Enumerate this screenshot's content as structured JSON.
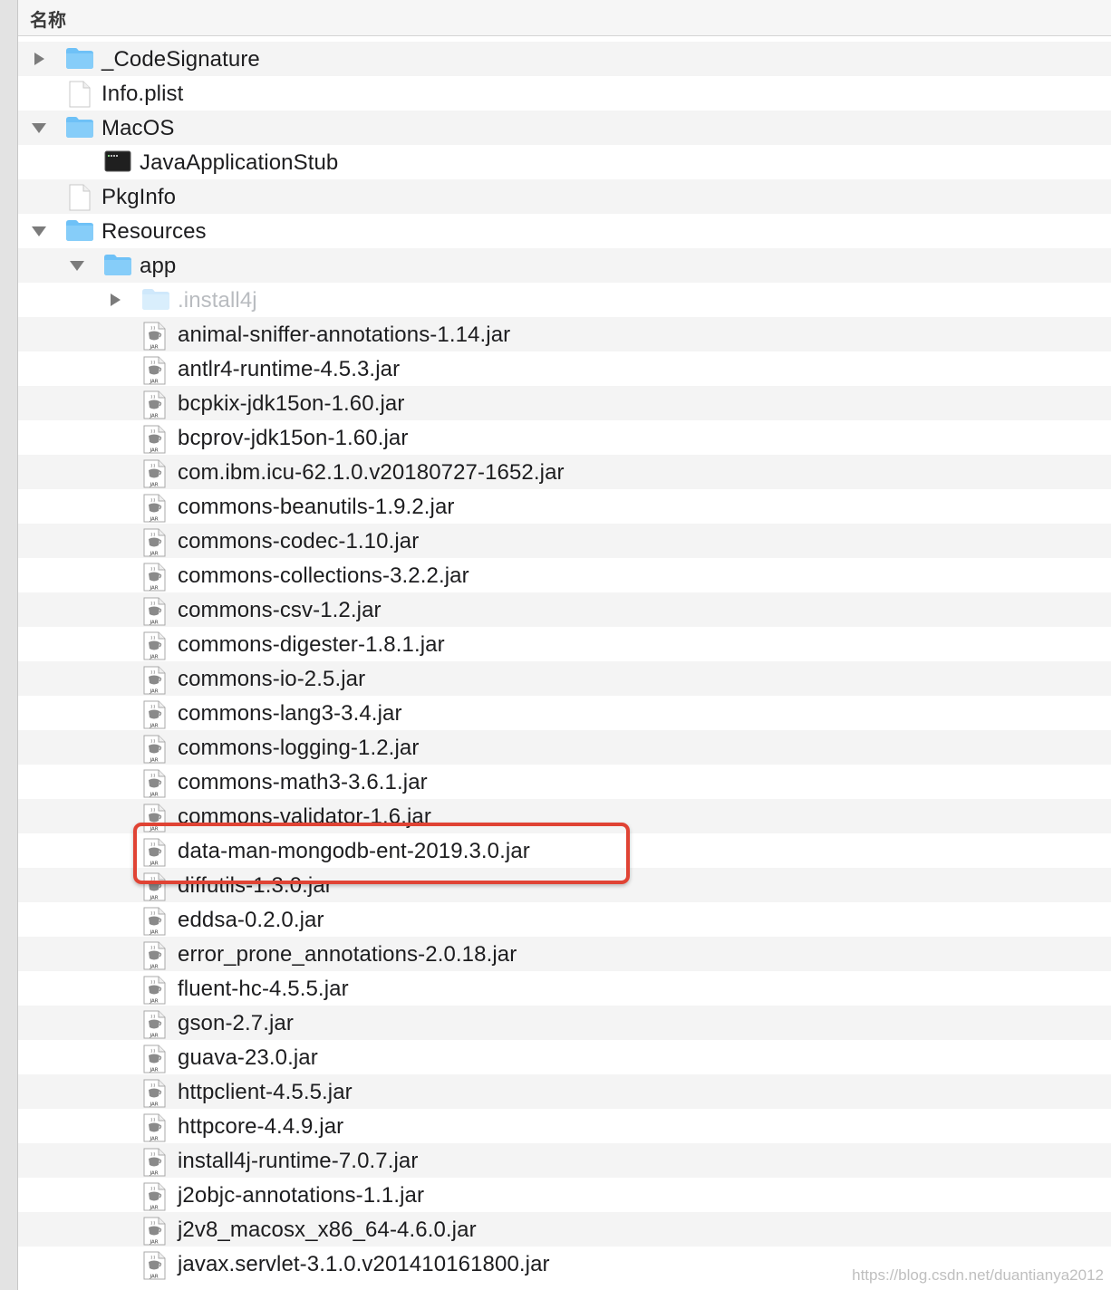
{
  "header": {
    "column_name": "名称"
  },
  "colors": {
    "folder": "#6ec1f7",
    "highlight": "#e04334",
    "row_alt": "#f4f4f4"
  },
  "rows": [
    {
      "label": "_CodeSignature",
      "icon": "folder-icon",
      "level": 0,
      "disclosure": "collapsed"
    },
    {
      "label": "Info.plist",
      "icon": "document-icon",
      "level": 0,
      "disclosure": "none"
    },
    {
      "label": "MacOS",
      "icon": "folder-icon",
      "level": 0,
      "disclosure": "expanded"
    },
    {
      "label": "JavaApplicationStub",
      "icon": "terminal-executable-icon",
      "level": 1,
      "disclosure": "none"
    },
    {
      "label": "PkgInfo",
      "icon": "document-icon",
      "level": 0,
      "disclosure": "none"
    },
    {
      "label": "Resources",
      "icon": "folder-icon",
      "level": 0,
      "disclosure": "expanded"
    },
    {
      "label": "app",
      "icon": "folder-icon",
      "level": 1,
      "disclosure": "expanded"
    },
    {
      "label": ".install4j",
      "icon": "folder-icon",
      "level": 2,
      "disclosure": "collapsed",
      "dim": true
    },
    {
      "label": "animal-sniffer-annotations-1.14.jar",
      "icon": "jar-icon",
      "level": 2
    },
    {
      "label": "antlr4-runtime-4.5.3.jar",
      "icon": "jar-icon",
      "level": 2
    },
    {
      "label": "bcpkix-jdk15on-1.60.jar",
      "icon": "jar-icon",
      "level": 2
    },
    {
      "label": "bcprov-jdk15on-1.60.jar",
      "icon": "jar-icon",
      "level": 2
    },
    {
      "label": "com.ibm.icu-62.1.0.v20180727-1652.jar",
      "icon": "jar-icon",
      "level": 2
    },
    {
      "label": "commons-beanutils-1.9.2.jar",
      "icon": "jar-icon",
      "level": 2
    },
    {
      "label": "commons-codec-1.10.jar",
      "icon": "jar-icon",
      "level": 2
    },
    {
      "label": "commons-collections-3.2.2.jar",
      "icon": "jar-icon",
      "level": 2
    },
    {
      "label": "commons-csv-1.2.jar",
      "icon": "jar-icon",
      "level": 2
    },
    {
      "label": "commons-digester-1.8.1.jar",
      "icon": "jar-icon",
      "level": 2
    },
    {
      "label": "commons-io-2.5.jar",
      "icon": "jar-icon",
      "level": 2
    },
    {
      "label": "commons-lang3-3.4.jar",
      "icon": "jar-icon",
      "level": 2
    },
    {
      "label": "commons-logging-1.2.jar",
      "icon": "jar-icon",
      "level": 2
    },
    {
      "label": "commons-math3-3.6.1.jar",
      "icon": "jar-icon",
      "level": 2
    },
    {
      "label": "commons-validator-1.6.jar",
      "icon": "jar-icon",
      "level": 2
    },
    {
      "label": "data-man-mongodb-ent-2019.3.0.jar",
      "icon": "jar-icon",
      "level": 2,
      "highlighted": true
    },
    {
      "label": "diffutils-1.3.0.jar",
      "icon": "jar-icon",
      "level": 2
    },
    {
      "label": "eddsa-0.2.0.jar",
      "icon": "jar-icon",
      "level": 2
    },
    {
      "label": "error_prone_annotations-2.0.18.jar",
      "icon": "jar-icon",
      "level": 2
    },
    {
      "label": "fluent-hc-4.5.5.jar",
      "icon": "jar-icon",
      "level": 2
    },
    {
      "label": "gson-2.7.jar",
      "icon": "jar-icon",
      "level": 2
    },
    {
      "label": "guava-23.0.jar",
      "icon": "jar-icon",
      "level": 2
    },
    {
      "label": "httpclient-4.5.5.jar",
      "icon": "jar-icon",
      "level": 2
    },
    {
      "label": "httpcore-4.4.9.jar",
      "icon": "jar-icon",
      "level": 2
    },
    {
      "label": "install4j-runtime-7.0.7.jar",
      "icon": "jar-icon",
      "level": 2
    },
    {
      "label": "j2objc-annotations-1.1.jar",
      "icon": "jar-icon",
      "level": 2
    },
    {
      "label": "j2v8_macosx_x86_64-4.6.0.jar",
      "icon": "jar-icon",
      "level": 2
    },
    {
      "label": "javax.servlet-3.1.0.v201410161800.jar",
      "icon": "jar-icon",
      "level": 2
    }
  ],
  "watermark": "https://blog.csdn.net/duantianya2012"
}
